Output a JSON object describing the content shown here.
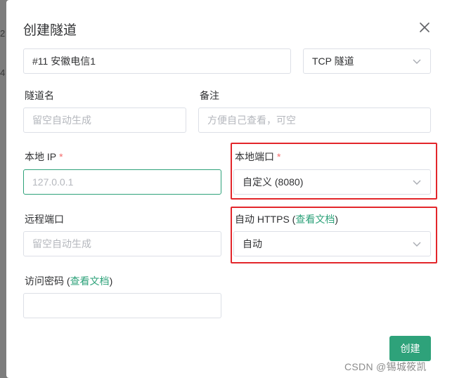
{
  "dialog": {
    "title": "创建隧道",
    "tunnel_name_value": "#11 安徽电信1",
    "tunnel_type": "TCP 隧道",
    "fields": {
      "name_label": "隧道名",
      "name_placeholder": "留空自动生成",
      "note_label": "备注",
      "note_placeholder": "方便自己查看，可空",
      "local_ip_label": "本地 IP",
      "local_ip_placeholder": "127.0.0.1",
      "local_port_label": "本地端口",
      "local_port_value": "自定义 (8080)",
      "remote_port_label": "远程端口",
      "remote_port_placeholder": "留空自动生成",
      "https_label": "自动 HTTPS (",
      "https_link": "查看文档",
      "https_close": ")",
      "https_value": "自动",
      "password_label": "访问密码 (",
      "password_link": "查看文档",
      "password_close": ")"
    },
    "required_mark": "*",
    "create_button": "创建"
  },
  "watermark": "CSDN @锡城筱凯",
  "colors": {
    "accent": "#2ea27a",
    "required": "#f56c6c",
    "highlight": "#e3262b"
  }
}
